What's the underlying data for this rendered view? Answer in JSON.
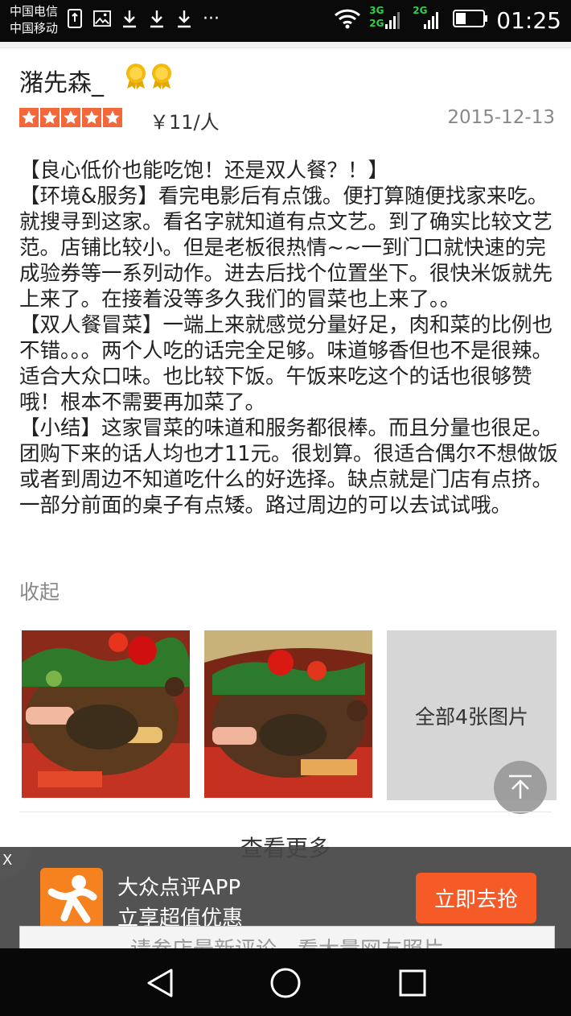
{
  "status_bar": {
    "carrier_1": "中国电信",
    "carrier_2": "中国移动",
    "network_1": "3G",
    "network_2": "2G",
    "network_3": "2G",
    "more": "···",
    "time": "01:25"
  },
  "review": {
    "username": "潴先森_",
    "rating_stars": 5,
    "price": "￥11/人",
    "date": "2015-12-13",
    "paragraphs": [
      "【良心低价也能吃饱！还是双人餐？！】",
      "【环境&服务】看完电影后有点饿。便打算随便找家来吃。就搜寻到这家。看名字就知道有点文艺。到了确实比较文艺范。店铺比较小。但是老板很热情~~一到门口就快速的完成验券等一系列动作。进去后找个位置坐下。很快米饭就先上来了。在接着没等多久我们的冒菜也上来了。。",
      "【双人餐冒菜】一端上来就感觉分量好足，肉和菜的比例也不错。。。两个人吃的话完全足够。味道够香但也不是很辣。适合大众口味。也比较下饭。午饭来吃这个的话也很够赞哦！根本不需要再加菜了。",
      "【小结】这家冒菜的味道和服务都很棒。而且分量也很足。团购下来的话人均也才11元。很划算。很适合偶尔不想做饭或者到周边不知道吃什么的好选择。缺点就是门店有点挤。一部分前面的桌子有点矮。路过周边的可以去试试哦。"
    ],
    "collapse_label": "收起",
    "all_photos_label": "全部4张图片"
  },
  "see_more_label": "查看更多",
  "app_banner": {
    "close_label": "X",
    "app_name": "大众点评APP",
    "tagline": "立享超值优惠",
    "button_label": "立即去抢",
    "underlying_text": "请参店最新评论，看大量网友照片"
  },
  "colors": {
    "star": "#f2683a",
    "button": "#f65b27",
    "logo": "#f5811f",
    "banner_bg": "#464646"
  },
  "icons": [
    "sim-icon",
    "image-icon",
    "download-icon",
    "wifi-icon",
    "signal-icon",
    "battery-icon",
    "medal-icon",
    "star-icon",
    "arrow-up-icon",
    "back-icon",
    "home-icon",
    "recents-icon"
  ]
}
